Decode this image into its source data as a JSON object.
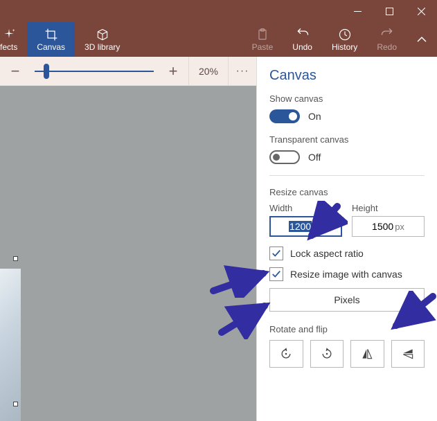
{
  "titlebar": {
    "minimize": "Minimize",
    "maximize": "Maximize",
    "close": "Close"
  },
  "ribbon": {
    "effects": "fects",
    "canvas": "Canvas",
    "library3d": "3D library",
    "paste": "Paste",
    "undo": "Undo",
    "history": "History",
    "redo": "Redo"
  },
  "zoom": {
    "percent": "20%",
    "more": "···"
  },
  "panel": {
    "title": "Canvas",
    "show_canvas_label": "Show canvas",
    "show_canvas_state": "On",
    "transparent_canvas_label": "Transparent canvas",
    "transparent_canvas_state": "Off",
    "resize_label": "Resize canvas",
    "width_label": "Width",
    "height_label": "Height",
    "width_value": "1200",
    "height_value": "1500",
    "unit_suffix": "px",
    "lock_aspect_label": "Lock aspect ratio",
    "resize_image_label": "Resize image with canvas",
    "unit_select": "Pixels",
    "rotate_flip_label": "Rotate and flip"
  }
}
